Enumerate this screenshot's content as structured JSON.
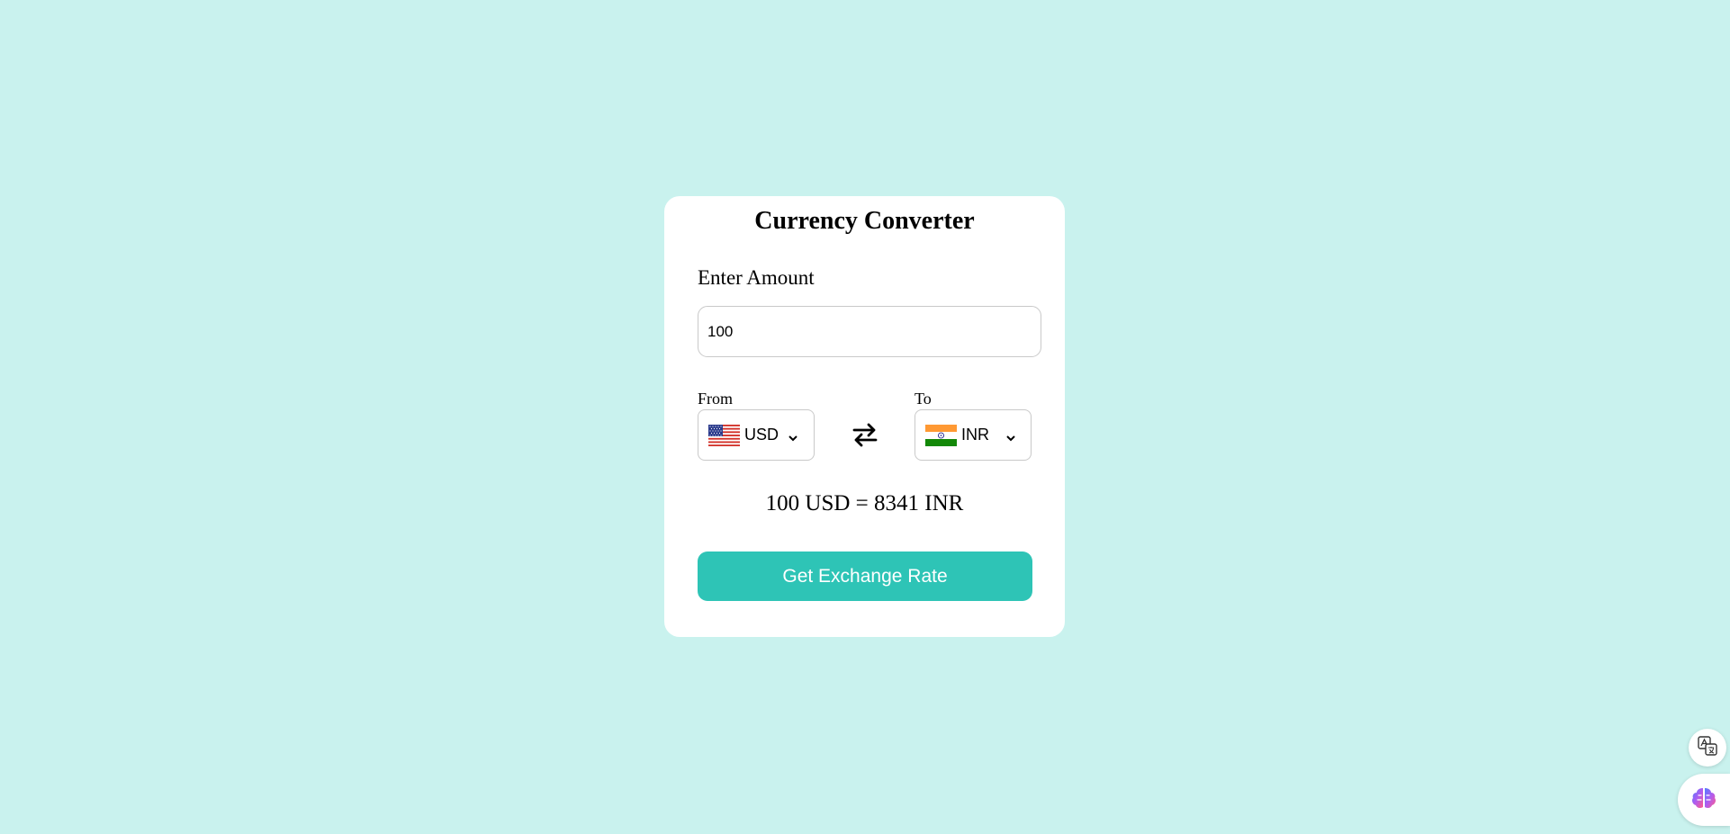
{
  "card": {
    "title": "Currency Converter",
    "amount_label": "Enter Amount",
    "amount_value": "100",
    "from_label": "From",
    "from_currency": "USD",
    "to_label": "To",
    "to_currency": "INR",
    "result_text": "100 USD = 8341 INR",
    "button_label": "Get Exchange Rate"
  },
  "icons": {
    "from_flag": "us-flag-icon",
    "to_flag": "india-flag-icon",
    "swap": "swap-arrows-icon",
    "translate": "translate-icon",
    "ai_assistant": "brain-icon"
  },
  "colors": {
    "background": "#c9f2ee",
    "button": "#2ec4b6",
    "card": "#ffffff"
  }
}
